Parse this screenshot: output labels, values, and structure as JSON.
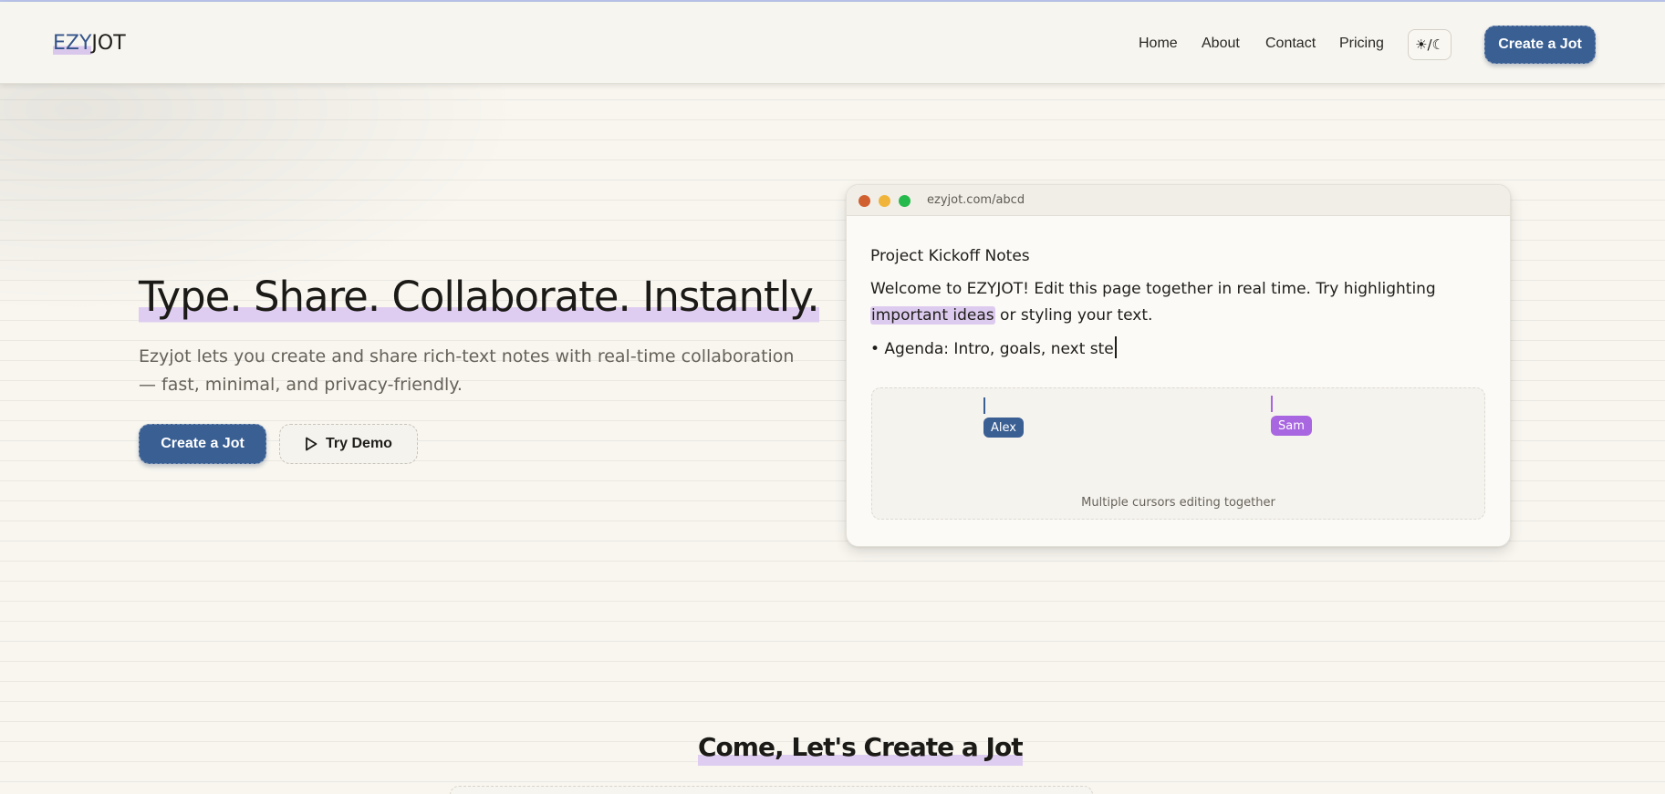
{
  "header": {
    "logo_ezy": "EZY",
    "logo_jot": "JOT",
    "nav": [
      "Home",
      "About",
      "Contact",
      "Pricing"
    ],
    "theme_toggle": "☀/☾",
    "cta": "Create a Jot"
  },
  "hero": {
    "title": "Type. Share. Collaborate. Instantly.",
    "subtitle": "Ezyjot lets you create and share rich-text notes with real-time collaboration — fast, minimal, and privacy-friendly.",
    "primary_cta": "Create a Jot",
    "secondary_cta": "Try Demo"
  },
  "editor": {
    "url": "ezyjot.com/abcd",
    "doc_title": "Project Kickoff Notes",
    "para_before": "Welcome to EZYJOT! Edit this page together in real time. Try highlighting ",
    "para_highlight": "important ideas",
    "para_after": " or styling your text.",
    "bullet": "• Agenda: Intro, goals, next ste",
    "cursors": [
      {
        "name": "Alex",
        "color": "#3a5f93"
      },
      {
        "name": "Sam",
        "color": "#a866e0"
      }
    ],
    "caption": "Multiple cursors editing together"
  },
  "section": {
    "title": "Come, Let's Create a Jot"
  },
  "colors": {
    "primary": "#3a5f93",
    "highlight": "#dccbee",
    "background": "#f8f6ef"
  }
}
